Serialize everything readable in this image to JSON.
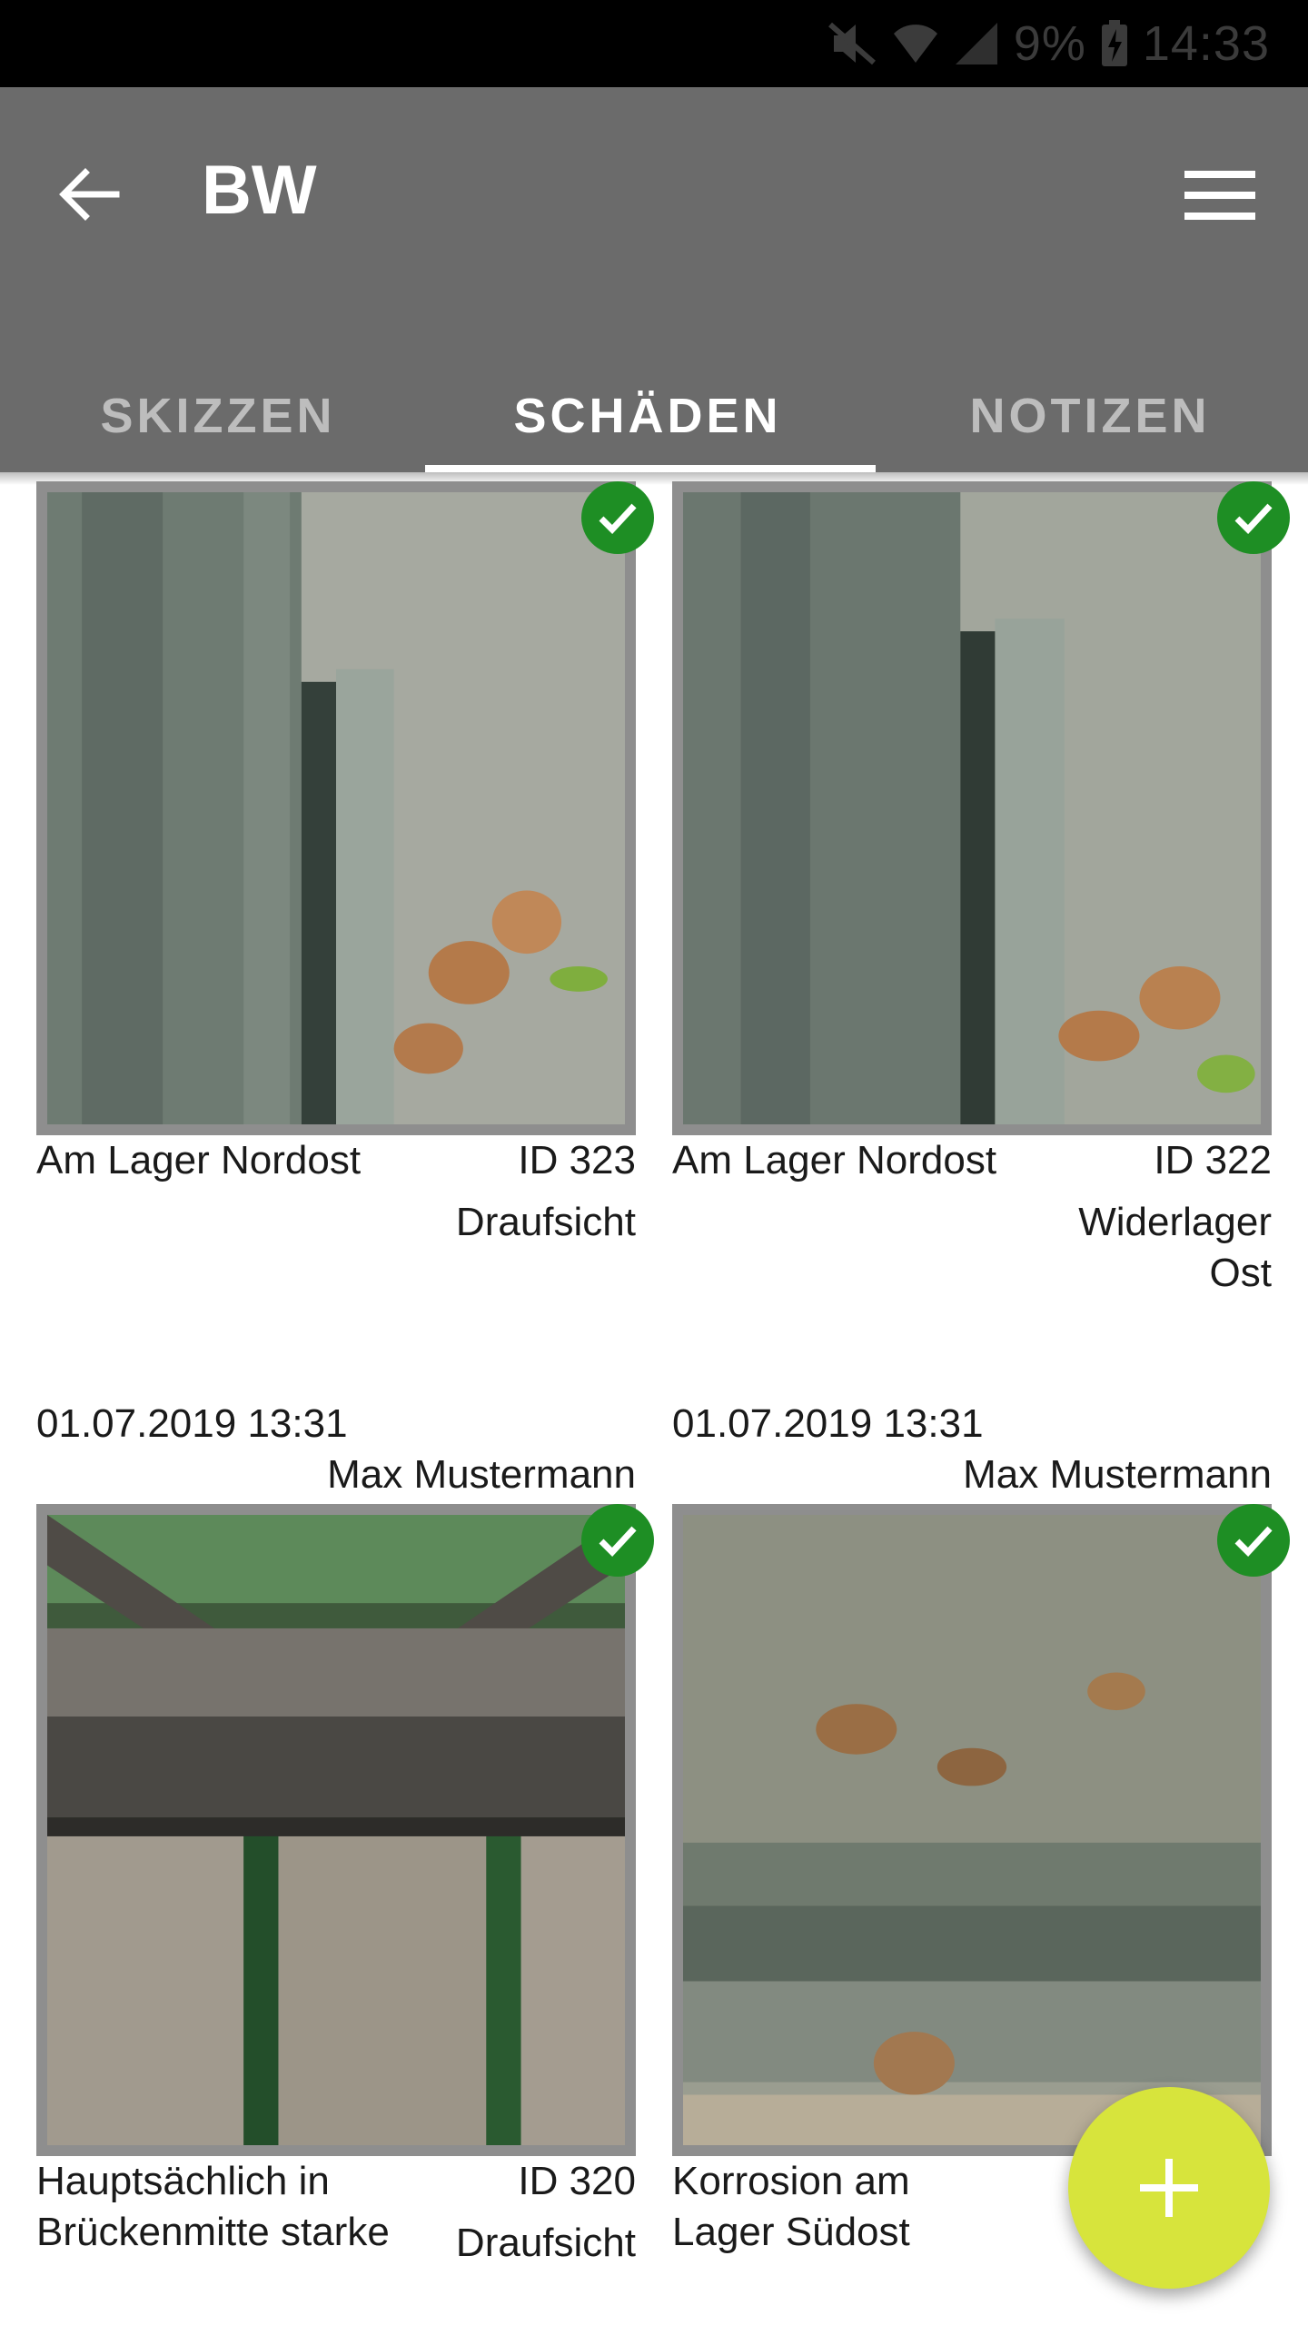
{
  "status": {
    "battery": "9%",
    "time": "14:33"
  },
  "header": {
    "title": "BW"
  },
  "tabs": [
    {
      "label": "SKIZZEN"
    },
    {
      "label": "SCHÄDEN"
    },
    {
      "label": "NOTIZEN"
    }
  ],
  "cards": [
    {
      "title": "Am Lager Nordost",
      "id": "ID 323",
      "view": "Draufsicht",
      "date": "01.07.2019 13:31",
      "author": "Max Mustermann"
    },
    {
      "title": "Am Lager Nordost",
      "id": "ID 322",
      "view": "Widerlager Ost",
      "date": "01.07.2019 13:31",
      "author": "Max Mustermann"
    },
    {
      "title": "Hauptsächlich in Brückenmitte starke",
      "id": "ID 320",
      "view": "Draufsicht"
    },
    {
      "title": "Korrosion am Lager Südost"
    }
  ],
  "colors": {
    "appbar": "#6b6b6b",
    "accent": "#ffffff",
    "check": "#1e8e24",
    "fab": "#d7e43c"
  }
}
